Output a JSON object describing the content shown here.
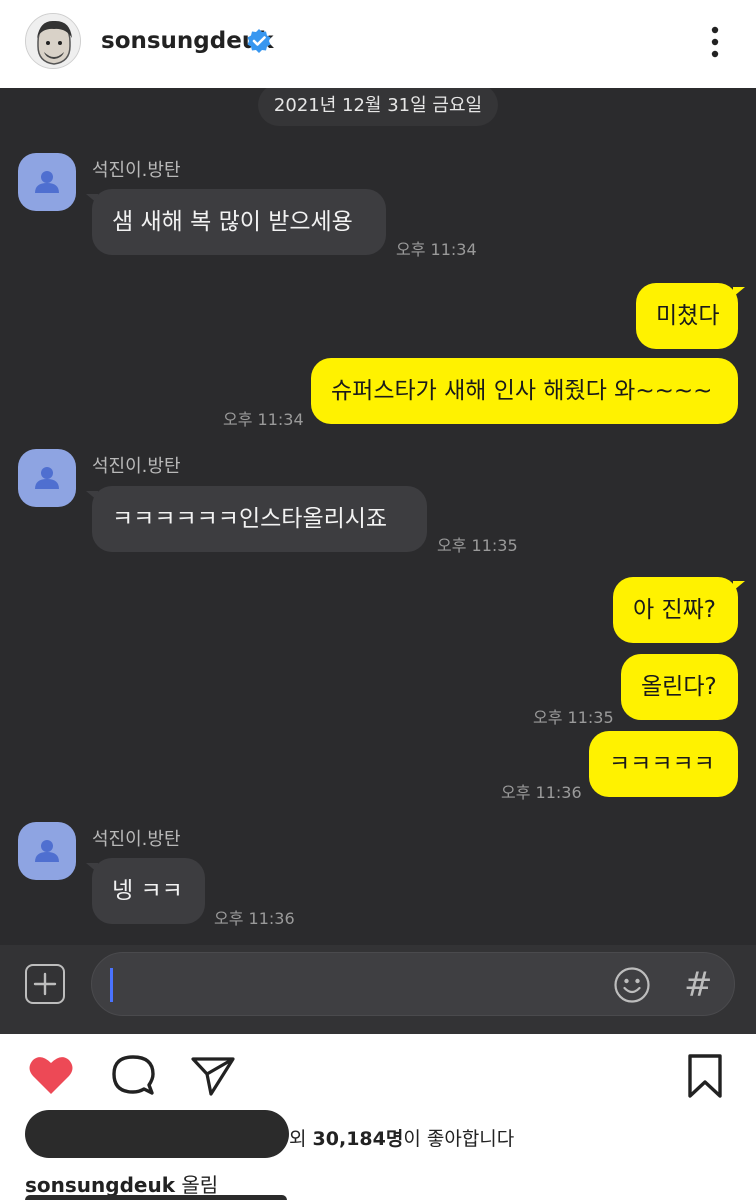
{
  "header": {
    "username": "sonsungdeuk"
  },
  "chat": {
    "date": "2021년 12월 31일 금요일",
    "messages": [
      {
        "sender": "석진이.방탄",
        "text": "샘 새해 복 많이 받으세용",
        "time": "오후 11:34"
      },
      {
        "text": "미쳤다"
      },
      {
        "text": "슈퍼스타가 새해 인사 해줬다 와~~~~",
        "time": "오후 11:34"
      },
      {
        "sender": "석진이.방탄",
        "text": "ㅋㅋㅋㅋㅋㅋ인스타올리시죠",
        "time": "오후 11:35"
      },
      {
        "text": "아 진짜?"
      },
      {
        "text": "올린다?",
        "time": "오후 11:35"
      },
      {
        "text": "ㅋㅋㅋㅋㅋ",
        "time": "오후 11:36"
      },
      {
        "sender": "석진이.방탄",
        "text": "넹 ㅋㅋ",
        "time": "오후 11:36"
      }
    ],
    "composer": {
      "hash": "#"
    }
  },
  "post": {
    "likes_prefix": "외 ",
    "likes_count": "30,184명",
    "likes_suffix": "이 좋아합니다",
    "caption_user": "sonsungdeuk",
    "caption_text": " 올림"
  },
  "colors": {
    "chat_bg": "#2b2b2d",
    "bubble_out": "#fff200",
    "bubble_in": "#3d3d40",
    "heart": "#ed4956",
    "verified": "#3897f0"
  }
}
